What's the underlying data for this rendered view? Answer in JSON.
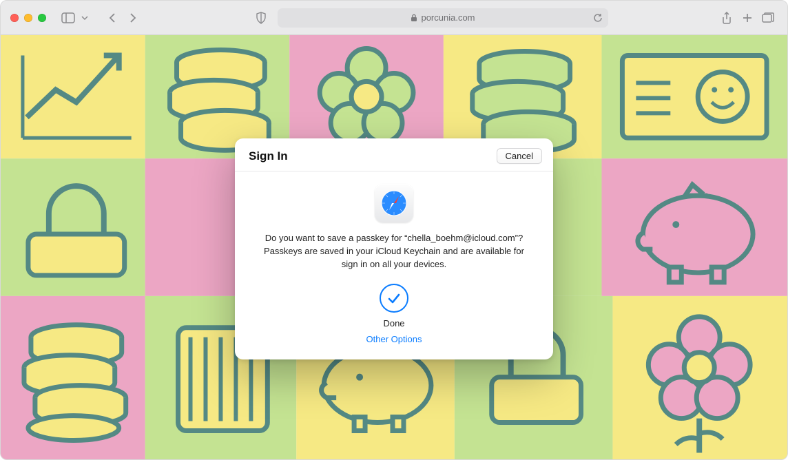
{
  "window": {
    "url_host": "porcunia.com",
    "lock_icon": "lock-icon"
  },
  "dialog": {
    "title": "Sign In",
    "cancel_label": "Cancel",
    "message": "Do you want to save a passkey for “chella_boehm@icloud.com”? Passkeys are saved in your iCloud Keychain and are available for sign in on all your devices.",
    "done_label": "Done",
    "other_options_label": "Other Options"
  }
}
